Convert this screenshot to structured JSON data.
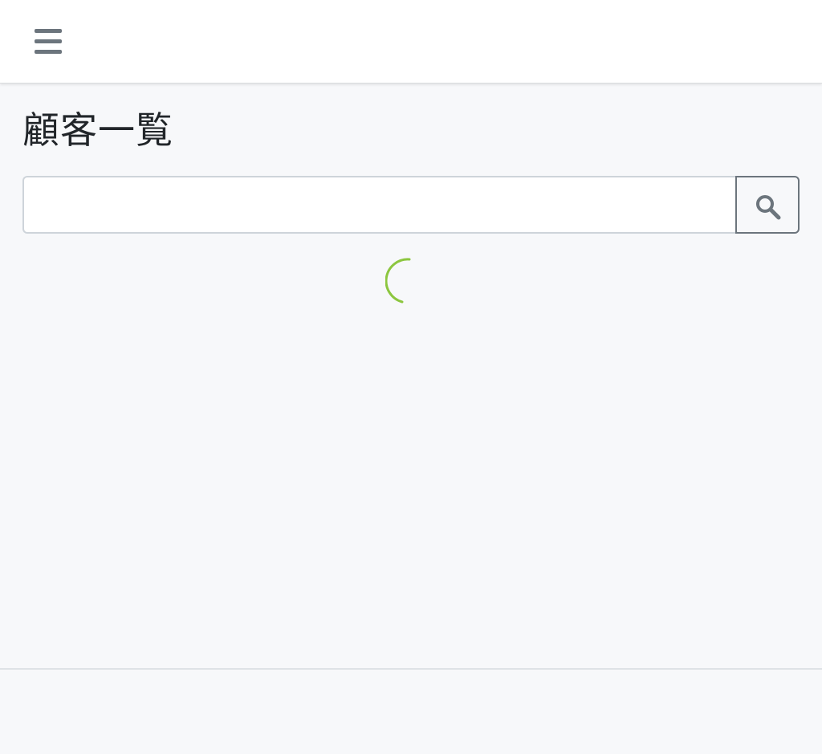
{
  "header": {
    "menu_icon": "hamburger-menu-icon"
  },
  "main": {
    "title": "顧客一覧",
    "search": {
      "value": "",
      "placeholder": "",
      "button_icon": "search-icon"
    },
    "loading_indicator": {
      "icon": "spinner-icon",
      "color": "#8cc63f"
    }
  },
  "colors": {
    "header_bg": "#ffffff",
    "page_bg": "#f7f8fa",
    "icon_gray": "#6c757d",
    "spinner_green": "#8cc63f"
  }
}
